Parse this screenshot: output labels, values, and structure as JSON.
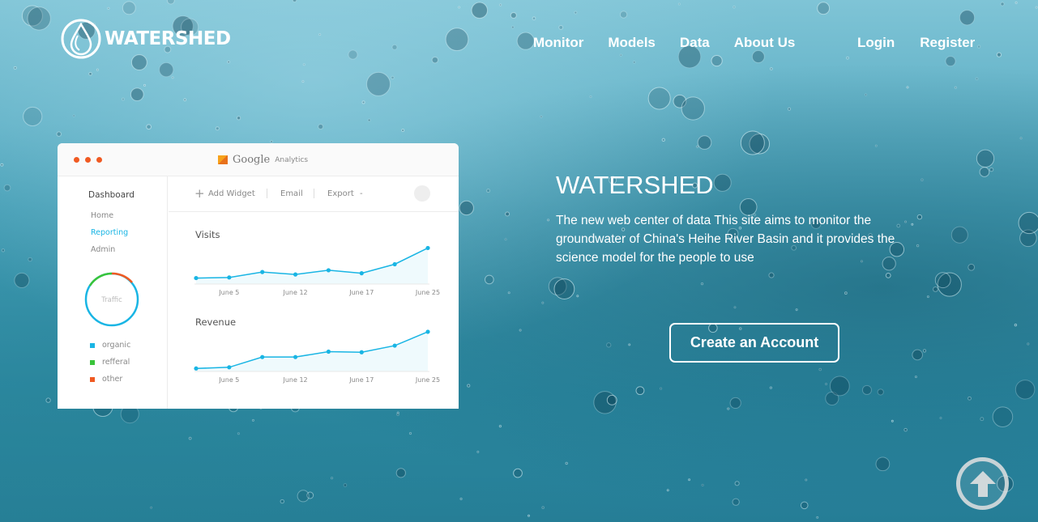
{
  "header": {
    "logo_text": "WATERSHED",
    "nav": [
      "Monitor",
      "Models",
      "Data",
      "About Us"
    ],
    "auth": {
      "login": "Login",
      "register": "Register"
    }
  },
  "dashboard": {
    "brand": "Google",
    "brand_sub": "Analytics",
    "sidebar_title": "Dashboard",
    "sidebar_links": [
      "Home",
      "Reporting",
      "Admin"
    ],
    "active_link": "Reporting",
    "ring_label": "Traffic",
    "legend": [
      {
        "label": "organic",
        "color": "#19b5e4"
      },
      {
        "label": "refferal",
        "color": "#39c43a"
      },
      {
        "label": "other",
        "color": "#f05a22"
      }
    ],
    "toolbar": {
      "add_widget": "Add Widget",
      "email": "Email",
      "export": "Export"
    },
    "line_color": "#19b5e4",
    "chart_data": [
      {
        "type": "line",
        "title": "Visits",
        "x": [
          "",
          "June 5",
          "",
          "June 12",
          "",
          "June 17",
          "",
          "June 25"
        ],
        "y": [
          10,
          11,
          20,
          16,
          23,
          18,
          33,
          60
        ]
      },
      {
        "type": "line",
        "title": "Revenue",
        "x": [
          "",
          "June 5",
          "",
          "June 12",
          "",
          "June 17",
          "",
          "June 25"
        ],
        "y": [
          5,
          7,
          24,
          24,
          33,
          32,
          43,
          66
        ]
      }
    ]
  },
  "hero": {
    "title": "WATERSHED",
    "description": "The new web center of data This site aims to monitor the groundwater of China's Heihe River Basin and it provides the science model for the people to use",
    "cta": "Create an Account"
  }
}
